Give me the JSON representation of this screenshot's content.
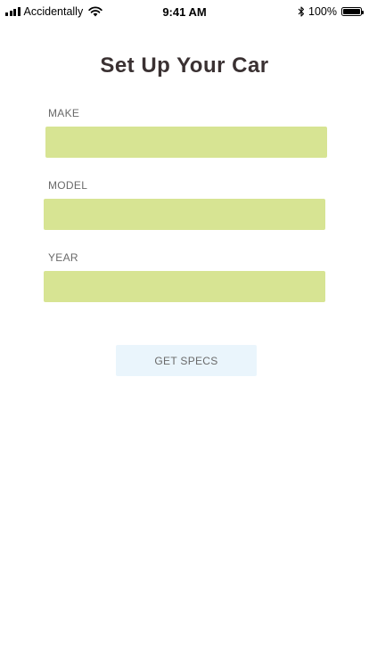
{
  "status_bar": {
    "carrier": "Accidentally",
    "time": "9:41 AM",
    "battery_percent": "100%",
    "icons": [
      "signal-icon",
      "wifi-icon",
      "bluetooth-icon",
      "battery-icon"
    ]
  },
  "page": {
    "title": "Set Up Your Car"
  },
  "form": {
    "make_label": "MAKE",
    "make_value": "",
    "model_label": "MODEL",
    "model_value": "",
    "year_label": "YEAR",
    "year_value": "",
    "input_color": "#d7e493"
  },
  "actions": {
    "get_specs_label": "GET SPECS",
    "button_color": "#eaf5fc"
  }
}
